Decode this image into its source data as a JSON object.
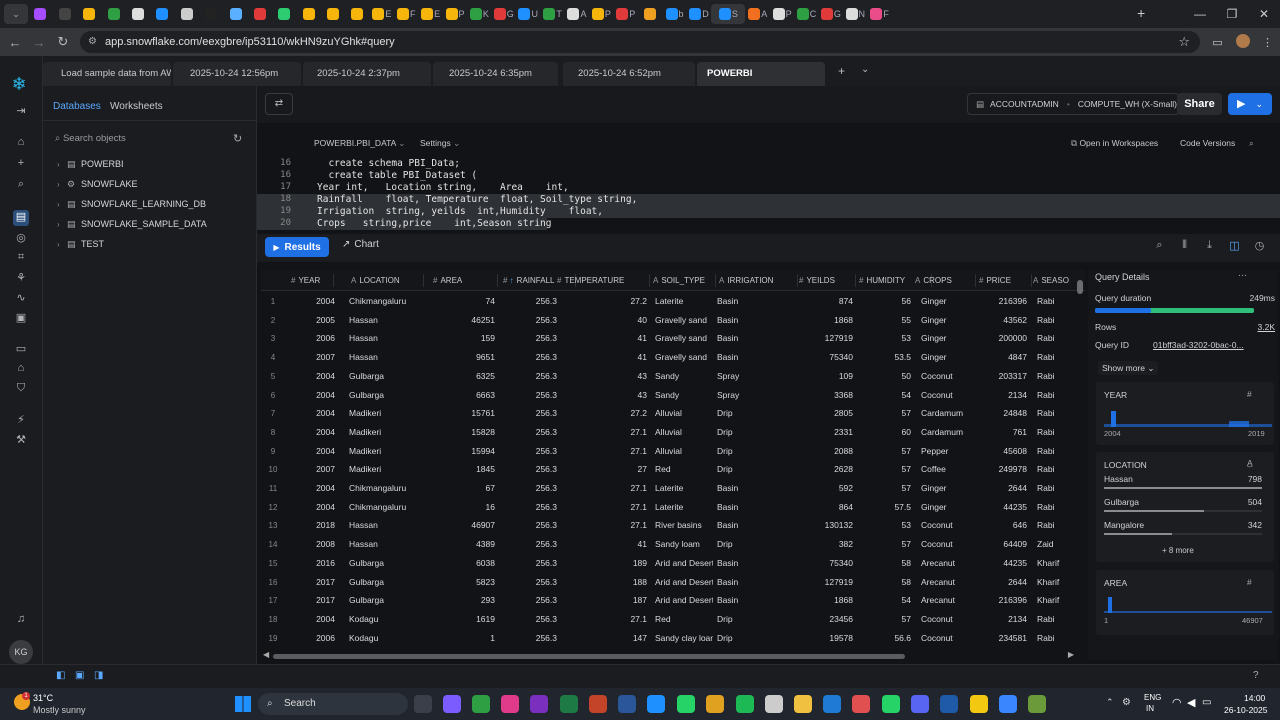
{
  "browser": {
    "tabs": [
      "",
      "",
      "",
      "",
      "",
      "",
      "",
      "",
      "",
      "",
      "",
      "",
      "",
      "",
      "E",
      "F",
      "E",
      "P",
      "K",
      "G",
      "U",
      "T",
      "A",
      "P",
      "P",
      "",
      "b",
      "D",
      "S",
      "A",
      "P",
      "C",
      "G",
      "N",
      "F"
    ],
    "url": "app.snowflake.com/eexgbre/ip53110/wkHN9zuYGhk#query"
  },
  "worksheet_tabs": [
    {
      "label": "Load sample data from AW..."
    },
    {
      "label": "2025-10-24 12:56pm"
    },
    {
      "label": "2025-10-24 2:37pm"
    },
    {
      "label": "2025-10-24 6:35pm"
    },
    {
      "label": "2025-10-24 6:52pm"
    },
    {
      "label": "POWERBI"
    }
  ],
  "sidebar": {
    "tab_databases": "Databases",
    "tab_worksheets": "Worksheets",
    "search_placeholder": "Search objects",
    "databases": [
      "POWERBI",
      "SNOWFLAKE",
      "SNOWFLAKE_LEARNING_DB",
      "SNOWFLAKE_SAMPLE_DATA",
      "TEST"
    ]
  },
  "toolbar": {
    "role": "ACCOUNTADMIN",
    "warehouse": "COMPUTE_WH (X-Small)",
    "share": "Share"
  },
  "context": {
    "db_schema": "POWERBI.PBI_DATA",
    "settings": "Settings",
    "open_in_workspaces": "Open in Workspaces",
    "code_versions": "Code Versions"
  },
  "editor": {
    "lines": [
      {
        "n": "16",
        "code": "  create schema PBI_Data;"
      },
      {
        "n": "16",
        "code": "  create table PBI_Dataset ("
      },
      {
        "n": "17",
        "code": "Year int,   Location string,    Area    int,"
      },
      {
        "n": "18",
        "code": "Rainfall    float, Temperature  float, Soil_type string,"
      },
      {
        "n": "19",
        "code": "Irrigation  string, yeilds  int,Humidity    float,"
      },
      {
        "n": "20",
        "code": "Crops   string,price    int,Season string"
      }
    ]
  },
  "results": {
    "results_label": "Results",
    "chart_label": "Chart",
    "columns": [
      "YEAR",
      "LOCATION",
      "AREA",
      "RAINFALL",
      "TEMPERATURE",
      "SOIL_TYPE",
      "IRRIGATION",
      "YEILDS",
      "HUMIDITY",
      "CROPS",
      "PRICE",
      "SEASO"
    ],
    "rows": [
      [
        "1",
        "2004",
        "Chikmangaluru",
        "74",
        "256.3",
        "27.2",
        "Laterite",
        "Basin",
        "874",
        "56",
        "Ginger",
        "216396",
        "Rabi"
      ],
      [
        "2",
        "2005",
        "Hassan",
        "46251",
        "256.3",
        "40",
        "Gravelly sand",
        "Basin",
        "1868",
        "55",
        "Ginger",
        "43562",
        "Rabi"
      ],
      [
        "3",
        "2006",
        "Hassan",
        "159",
        "256.3",
        "41",
        "Gravelly sand",
        "Basin",
        "127919",
        "53",
        "Ginger",
        "200000",
        "Rabi"
      ],
      [
        "4",
        "2007",
        "Hassan",
        "9651",
        "256.3",
        "41",
        "Gravelly sand",
        "Basin",
        "75340",
        "53.5",
        "Ginger",
        "4847",
        "Rabi"
      ],
      [
        "5",
        "2004",
        "Gulbarga",
        "6325",
        "256.3",
        "43",
        "Sandy",
        "Spray",
        "109",
        "50",
        "Coconut",
        "203317",
        "Rabi"
      ],
      [
        "6",
        "2004",
        "Gulbarga",
        "6663",
        "256.3",
        "43",
        "Sandy",
        "Spray",
        "3368",
        "54",
        "Coconut",
        "2134",
        "Rabi"
      ],
      [
        "7",
        "2004",
        "Madikeri",
        "15761",
        "256.3",
        "27.2",
        "Alluvial",
        "Drip",
        "2805",
        "57",
        "Cardamum",
        "24848",
        "Rabi"
      ],
      [
        "8",
        "2004",
        "Madikeri",
        "15828",
        "256.3",
        "27.1",
        "Alluvial",
        "Drip",
        "2331",
        "60",
        "Cardamum",
        "761",
        "Rabi"
      ],
      [
        "9",
        "2004",
        "Madikeri",
        "15994",
        "256.3",
        "27.1",
        "Alluvial",
        "Drip",
        "2088",
        "57",
        "Pepper",
        "45608",
        "Rabi"
      ],
      [
        "10",
        "2007",
        "Madikeri",
        "1845",
        "256.3",
        "27",
        "Red",
        "Drip",
        "2628",
        "57",
        "Coffee",
        "249978",
        "Rabi"
      ],
      [
        "11",
        "2004",
        "Chikmangaluru",
        "67",
        "256.3",
        "27.1",
        "Laterite",
        "Basin",
        "592",
        "57",
        "Ginger",
        "2644",
        "Rabi"
      ],
      [
        "12",
        "2004",
        "Chikmangaluru",
        "16",
        "256.3",
        "27.1",
        "Laterite",
        "Basin",
        "864",
        "57.5",
        "Ginger",
        "44235",
        "Rabi"
      ],
      [
        "13",
        "2018",
        "Hassan",
        "46907",
        "256.3",
        "27.1",
        "River basins",
        "Basin",
        "130132",
        "53",
        "Coconut",
        "646",
        "Rabi"
      ],
      [
        "14",
        "2008",
        "Hassan",
        "4389",
        "256.3",
        "41",
        "Sandy loam",
        "Drip",
        "382",
        "57",
        "Coconut",
        "64409",
        "Zaid"
      ],
      [
        "15",
        "2016",
        "Gulbarga",
        "6038",
        "256.3",
        "189",
        "Arid and Desert",
        "Basin",
        "75340",
        "58",
        "Arecanut",
        "44235",
        "Kharif"
      ],
      [
        "16",
        "2017",
        "Gulbarga",
        "5823",
        "256.3",
        "188",
        "Arid and Desert",
        "Basin",
        "127919",
        "58",
        "Arecanut",
        "2644",
        "Kharif"
      ],
      [
        "17",
        "2017",
        "Gulbarga",
        "293",
        "256.3",
        "187",
        "Arid and Desert",
        "Basin",
        "1868",
        "54",
        "Arecanut",
        "216396",
        "Kharif"
      ],
      [
        "18",
        "2004",
        "Kodagu",
        "1619",
        "256.3",
        "27.1",
        "Red",
        "Drip",
        "23456",
        "57",
        "Coconut",
        "2134",
        "Rabi"
      ],
      [
        "19",
        "2006",
        "Kodagu",
        "1",
        "256.3",
        "147",
        "Sandy clay loam",
        "Drip",
        "19578",
        "56.6",
        "Coconut",
        "234581",
        "Rabi"
      ]
    ]
  },
  "query_details": {
    "title": "Query Details",
    "duration_label": "Query duration",
    "duration": "249ms",
    "duration_fraction": 0.35,
    "rows_label": "Rows",
    "rows": "3.2K",
    "query_id_label": "Query ID",
    "query_id": "01bff3ad-3202-0bac-0...",
    "show_more": "Show more",
    "year_card": {
      "title": "YEAR",
      "min": "2004",
      "max": "2019"
    },
    "location_card": {
      "title": "LOCATION",
      "items": [
        {
          "name": "Hassan",
          "count": "798",
          "fraction": 1.0
        },
        {
          "name": "Gulbarga",
          "count": "504",
          "fraction": 0.63
        },
        {
          "name": "Mangalore",
          "count": "342",
          "fraction": 0.43
        }
      ],
      "more": "+ 8 more"
    },
    "area_card": {
      "title": "AREA",
      "min": "1",
      "max": "46907"
    }
  },
  "user_initials": "KG",
  "taskbar": {
    "weather_temp": "31°C",
    "weather_desc": "Mostly sunny",
    "search": "Search",
    "lang1": "ENG",
    "lang2": "IN",
    "time": "14:00",
    "date": "26-10-2025"
  },
  "colors": {
    "accent": "#1f6fe5",
    "snowflake": "#29b5e8"
  }
}
